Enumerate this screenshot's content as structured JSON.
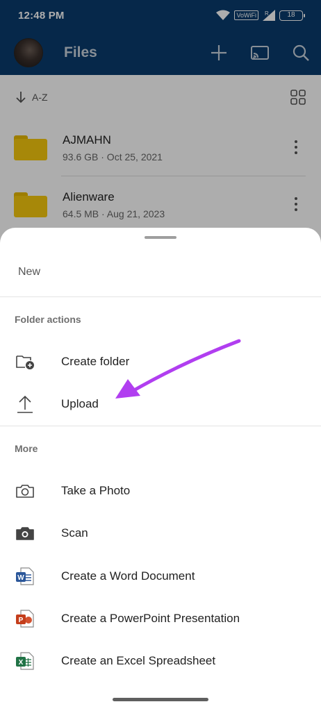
{
  "status_bar": {
    "time": "12:48 PM",
    "network_label": "VoWiFi",
    "signal_tag": "R",
    "battery": "18"
  },
  "app_bar": {
    "title": "Files",
    "icons": [
      "avatar",
      "plus-icon",
      "cast-icon",
      "search-icon"
    ]
  },
  "sort": {
    "label": "A-Z",
    "icons": [
      "arrow-down-icon",
      "grid-view-icon"
    ]
  },
  "files": [
    {
      "name": "AJMAHN",
      "meta": "93.6 GB · Oct 25, 2021"
    },
    {
      "name": "Alienware",
      "meta": "64.5 MB · Aug 21, 2023"
    }
  ],
  "sheet": {
    "new_label": "New",
    "folder_actions_title": "Folder actions",
    "folder_actions": [
      {
        "label": "Create folder",
        "icon": "add-folder-icon"
      },
      {
        "label": "Upload",
        "icon": "upload-icon"
      }
    ],
    "more_title": "More",
    "more": [
      {
        "label": "Take a Photo",
        "icon": "camera-outline-icon"
      },
      {
        "label": "Scan",
        "icon": "camera-filled-icon"
      },
      {
        "label": "Create a Word Document",
        "icon": "word-icon"
      },
      {
        "label": "Create a PowerPoint Presentation",
        "icon": "powerpoint-icon"
      },
      {
        "label": "Create an Excel Spreadsheet",
        "icon": "excel-icon"
      }
    ]
  },
  "colors": {
    "app_bar": "#0a3c6e",
    "folder": "#f6c90e",
    "annotation_arrow": "#b13ef0",
    "word": "#2b579a",
    "powerpoint": "#c43e1c",
    "excel": "#217346"
  }
}
